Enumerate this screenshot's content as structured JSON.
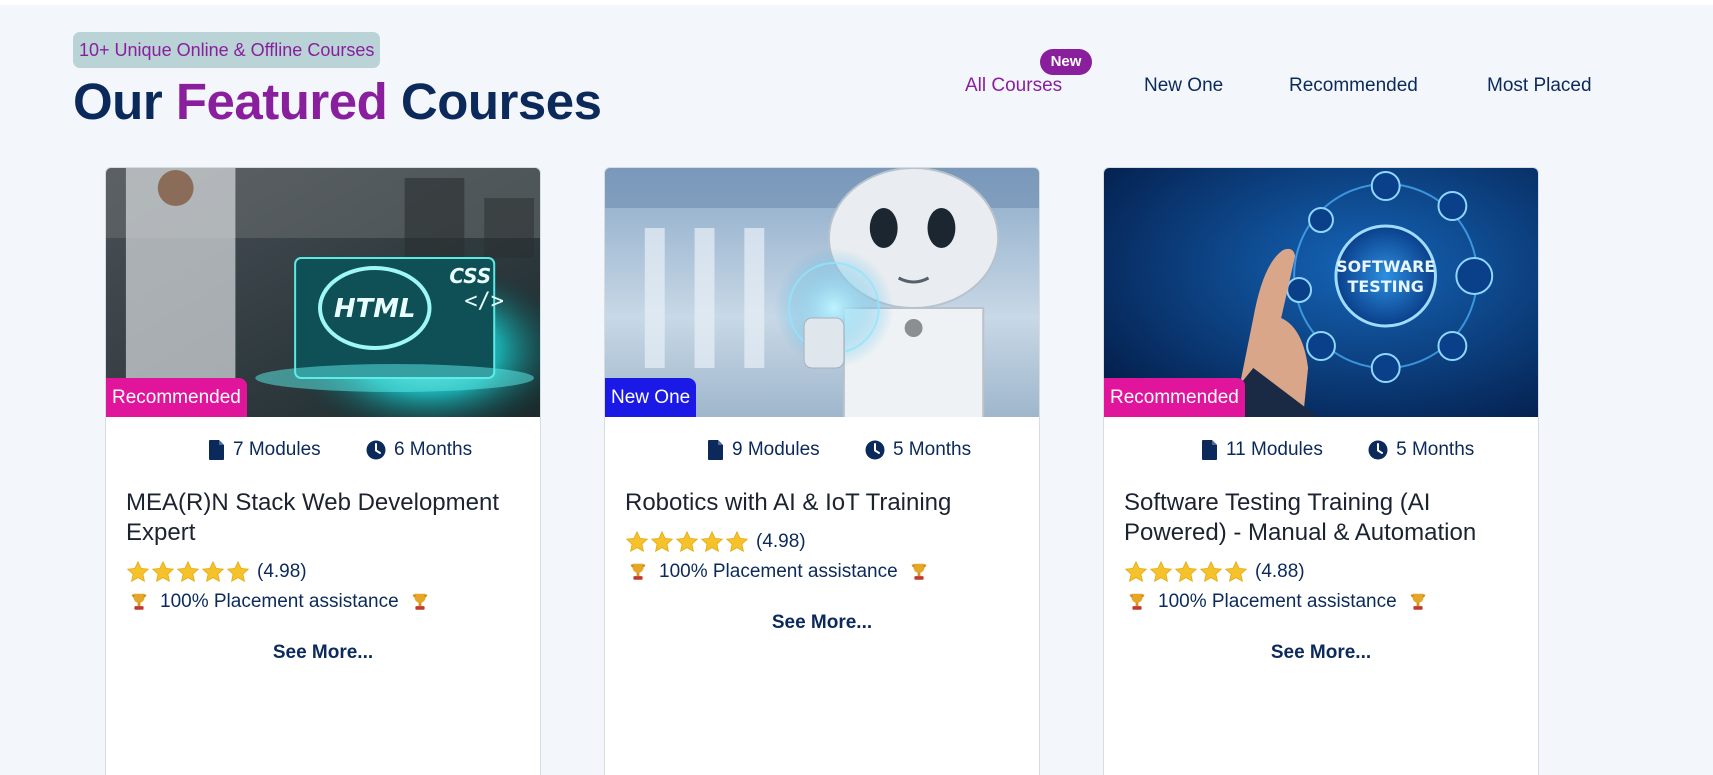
{
  "header": {
    "tagline": "10+ Unique Online & Offline Courses",
    "title_part1": "Our",
    "title_accent": "Featured",
    "title_part2": "Courses"
  },
  "filters": {
    "new_badge": "New",
    "items": [
      {
        "label": "All Courses",
        "active": true
      },
      {
        "label": "New One",
        "active": false
      },
      {
        "label": "Recommended",
        "active": false
      },
      {
        "label": "Most Placed",
        "active": false
      }
    ]
  },
  "colors": {
    "brand_purple": "#8a1f9e",
    "navy": "#0b2a5b",
    "badge_pink": "#e0159c",
    "badge_blue": "#1a19e6",
    "star_yellow": "#f6c22b"
  },
  "courses": [
    {
      "image": "html-css-laptop",
      "badge": "Recommended",
      "modules": "7 Modules",
      "duration": "6 Months",
      "title": "MEA(R)N Stack Web Development Expert",
      "rating": "(4.98)",
      "stars": 5,
      "placement": "100% Placement assistance",
      "see_more": "See More..."
    },
    {
      "image": "robot-ai-hologram",
      "badge": "New One",
      "modules": "9 Modules",
      "duration": "5 Months",
      "title": "Robotics with AI & IoT Training",
      "rating": "(4.98)",
      "stars": 5,
      "placement": "100% Placement assistance",
      "see_more": "See More..."
    },
    {
      "image": "software-testing-hand",
      "badge": "Recommended",
      "modules": "11 Modules",
      "duration": "5 Months",
      "title": "Software Testing Training (AI Powered) - Manual & Automation",
      "rating": "(4.88)",
      "stars": 5,
      "placement": "100% Placement assistance",
      "see_more": "See More..."
    }
  ]
}
